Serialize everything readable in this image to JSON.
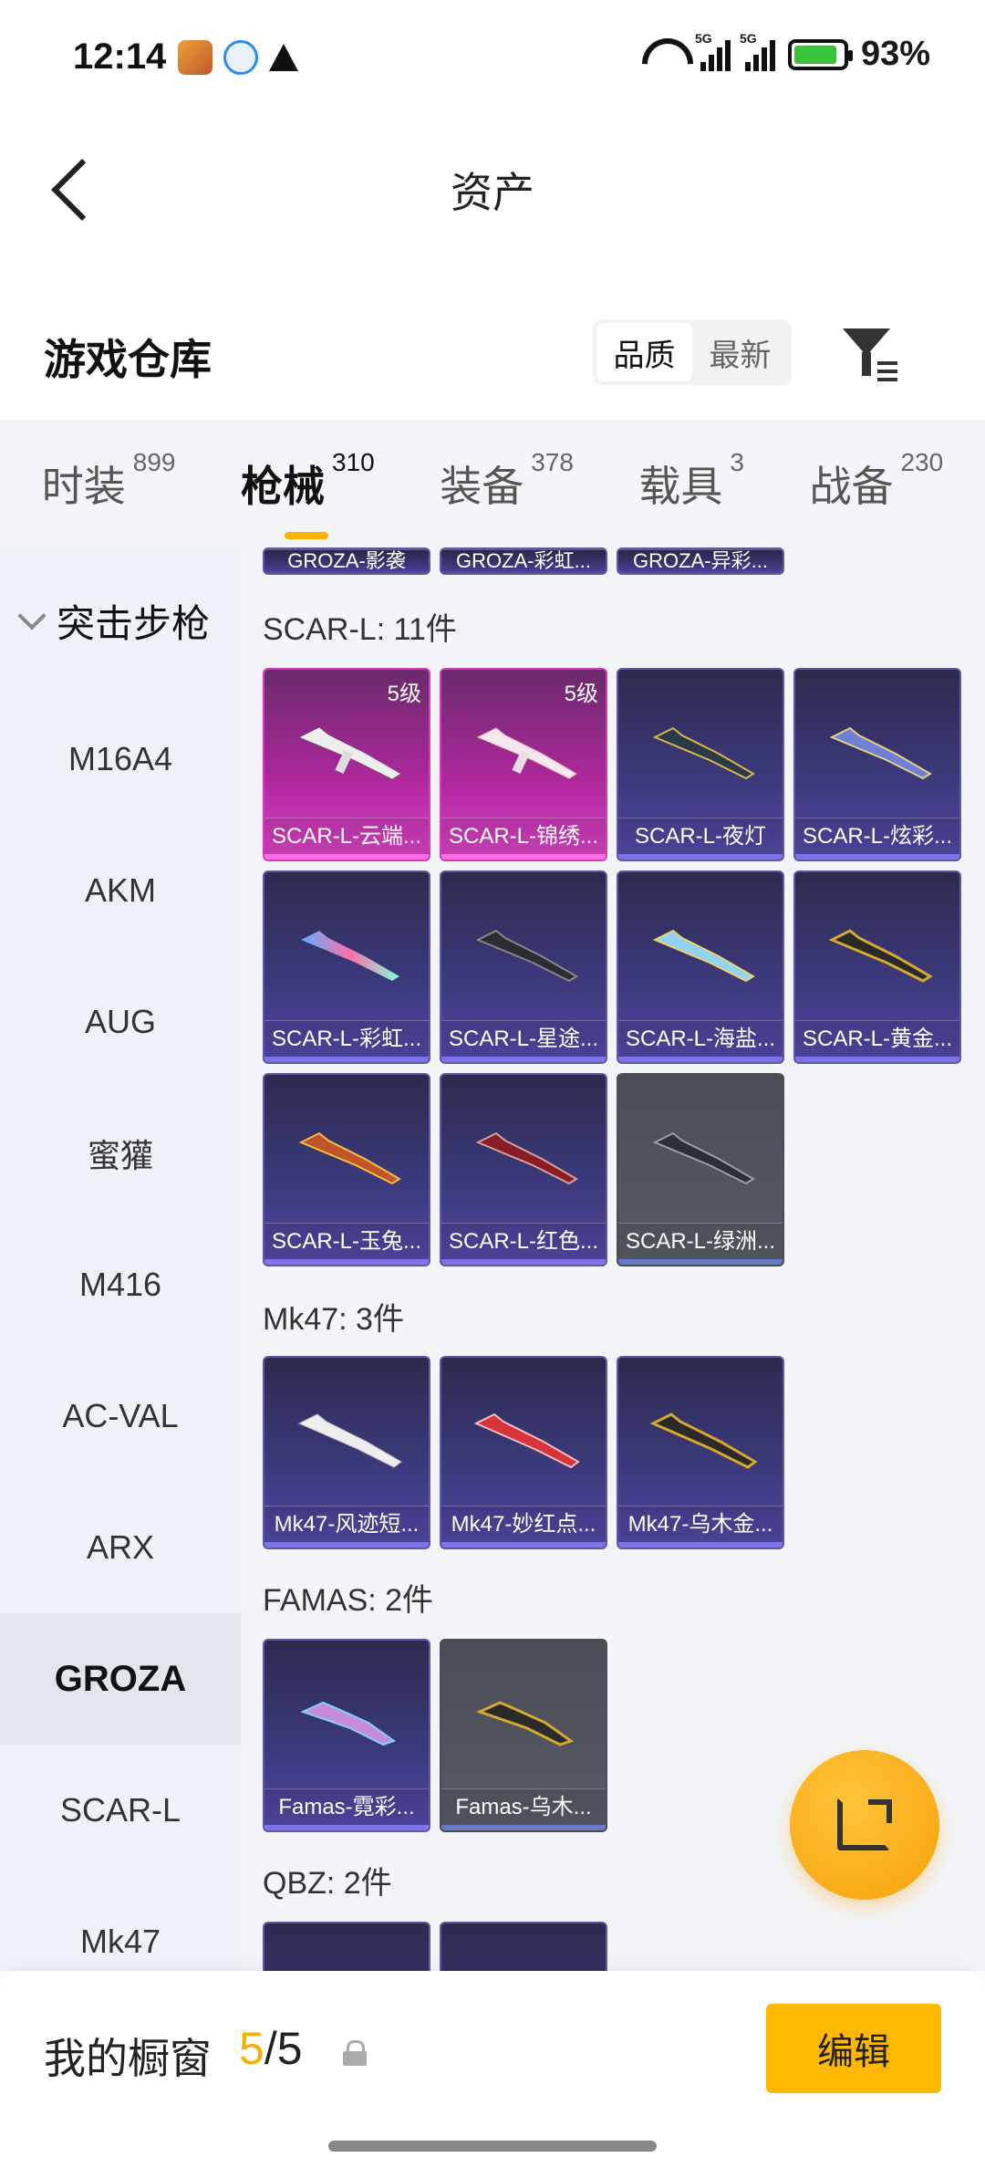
{
  "status": {
    "time": "12:14",
    "battery": "93%",
    "net1": "5G",
    "net2": "5G"
  },
  "header": {
    "title": "资产"
  },
  "warehouse": {
    "title": "游戏仓库",
    "sort_quality": "品质",
    "sort_newest": "最新"
  },
  "tabs": [
    {
      "label": "时装",
      "count": "899"
    },
    {
      "label": "枪械",
      "count": "310"
    },
    {
      "label": "装备",
      "count": "378"
    },
    {
      "label": "载具",
      "count": "3"
    },
    {
      "label": "战备",
      "count": "230"
    }
  ],
  "sidebar": {
    "group": "突击步枪",
    "items": [
      "M16A4",
      "AKM",
      "AUG",
      "蜜獾",
      "M416",
      "AC-VAL",
      "ARX",
      "GROZA",
      "SCAR-L",
      "Mk47"
    ]
  },
  "sections": {
    "groza_partial": [
      "GROZA-影袭",
      "GROZA-彩虹...",
      "GROZA-异彩..."
    ],
    "scar": {
      "title": "SCAR-L: 11件",
      "items": [
        {
          "name": "SCAR-L-云端...",
          "level": "5级"
        },
        {
          "name": "SCAR-L-锦绣...",
          "level": "5级"
        },
        {
          "name": "SCAR-L-夜灯"
        },
        {
          "name": "SCAR-L-炫彩..."
        },
        {
          "name": "SCAR-L-彩虹..."
        },
        {
          "name": "SCAR-L-星途..."
        },
        {
          "name": "SCAR-L-海盐..."
        },
        {
          "name": "SCAR-L-黄金..."
        },
        {
          "name": "SCAR-L-玉兔..."
        },
        {
          "name": "SCAR-L-红色..."
        },
        {
          "name": "SCAR-L-绿洲..."
        }
      ]
    },
    "mk47": {
      "title": "Mk47: 3件",
      "items": [
        {
          "name": "Mk47-风迹短..."
        },
        {
          "name": "Mk47-妙红点..."
        },
        {
          "name": "Mk47-乌木金..."
        }
      ]
    },
    "famas": {
      "title": "FAMAS: 2件",
      "items": [
        {
          "name": "Famas-霓彩..."
        },
        {
          "name": "Famas-乌木..."
        }
      ]
    },
    "qbz": {
      "title": "QBZ: 2件"
    }
  },
  "bottom": {
    "label": "我的橱窗",
    "count_current": "5",
    "count_sep": "/",
    "count_total": "5",
    "edit": "编辑"
  },
  "colors": {
    "accent": "#ffb800",
    "legendary": "#d845c4",
    "epic": "#5249a6",
    "common": "#575a63"
  },
  "icons": [
    "back-icon",
    "filter-icon",
    "share-icon",
    "lock-icon",
    "chevron-down-icon"
  ]
}
